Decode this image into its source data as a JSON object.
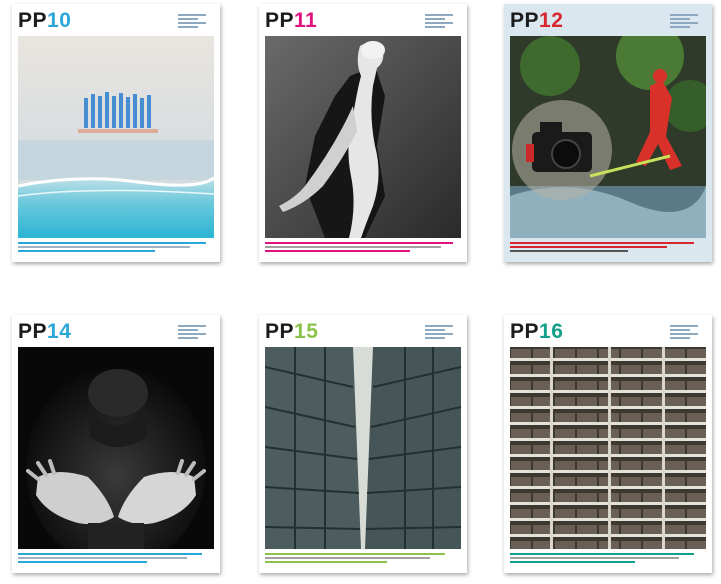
{
  "covers": [
    {
      "prefix": "PP",
      "number": "10",
      "number_color": "#2aa6d8",
      "footer_color": "#2aa6d8"
    },
    {
      "prefix": "PP",
      "number": "11",
      "number_color": "#e0127f",
      "footer_color": "#e0127f"
    },
    {
      "prefix": "PP",
      "number": "12",
      "number_color": "#d8262e",
      "footer_color": "#d8262e"
    },
    {
      "prefix": "PP",
      "number": "14",
      "number_color": "#2aa6d8",
      "footer_color": "#2aa6d8"
    },
    {
      "prefix": "PP",
      "number": "15",
      "number_color": "#8bc34a",
      "footer_color": "#8bc34a"
    },
    {
      "prefix": "PP",
      "number": "16",
      "number_color": "#12a08a",
      "footer_color": "#12a08a"
    }
  ]
}
